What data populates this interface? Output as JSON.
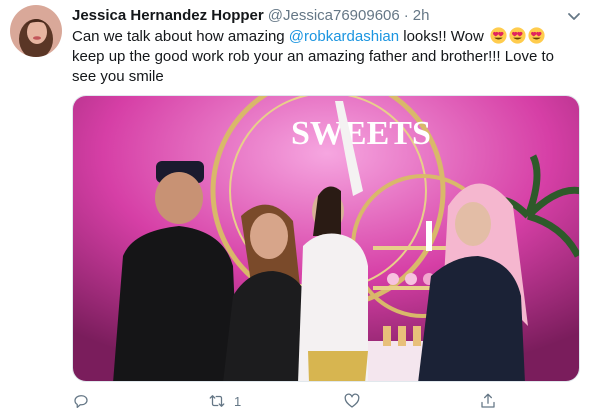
{
  "tweet": {
    "author": {
      "display_name": "Jessica Hernandez Hopper",
      "handle": "@Jessica76909606"
    },
    "separator": "·",
    "timestamp": "2h",
    "text": {
      "part1": "Can we talk about how amazing ",
      "mention": "@robkardashian",
      "part2": " looks!! Wow ",
      "emojis": [
        "heart-eyes-emoji",
        "heart-eyes-emoji",
        "heart-eyes-emoji"
      ],
      "part3": " keep up the good work rob your an amazing father and brother!!! Love to see you smile"
    },
    "media": {
      "sign_text": "SWEETS",
      "colors": {
        "background": "#d63fa6",
        "light": "#f6a6e0"
      }
    },
    "actions": {
      "reply": {
        "icon": "reply-icon",
        "count": ""
      },
      "retweet": {
        "icon": "retweet-icon",
        "count": "1"
      },
      "like": {
        "icon": "heart-icon",
        "count": ""
      },
      "share": {
        "icon": "share-icon",
        "count": ""
      }
    }
  },
  "colors": {
    "text": "#14171a",
    "secondary": "#657786",
    "link": "#1b95e0"
  }
}
